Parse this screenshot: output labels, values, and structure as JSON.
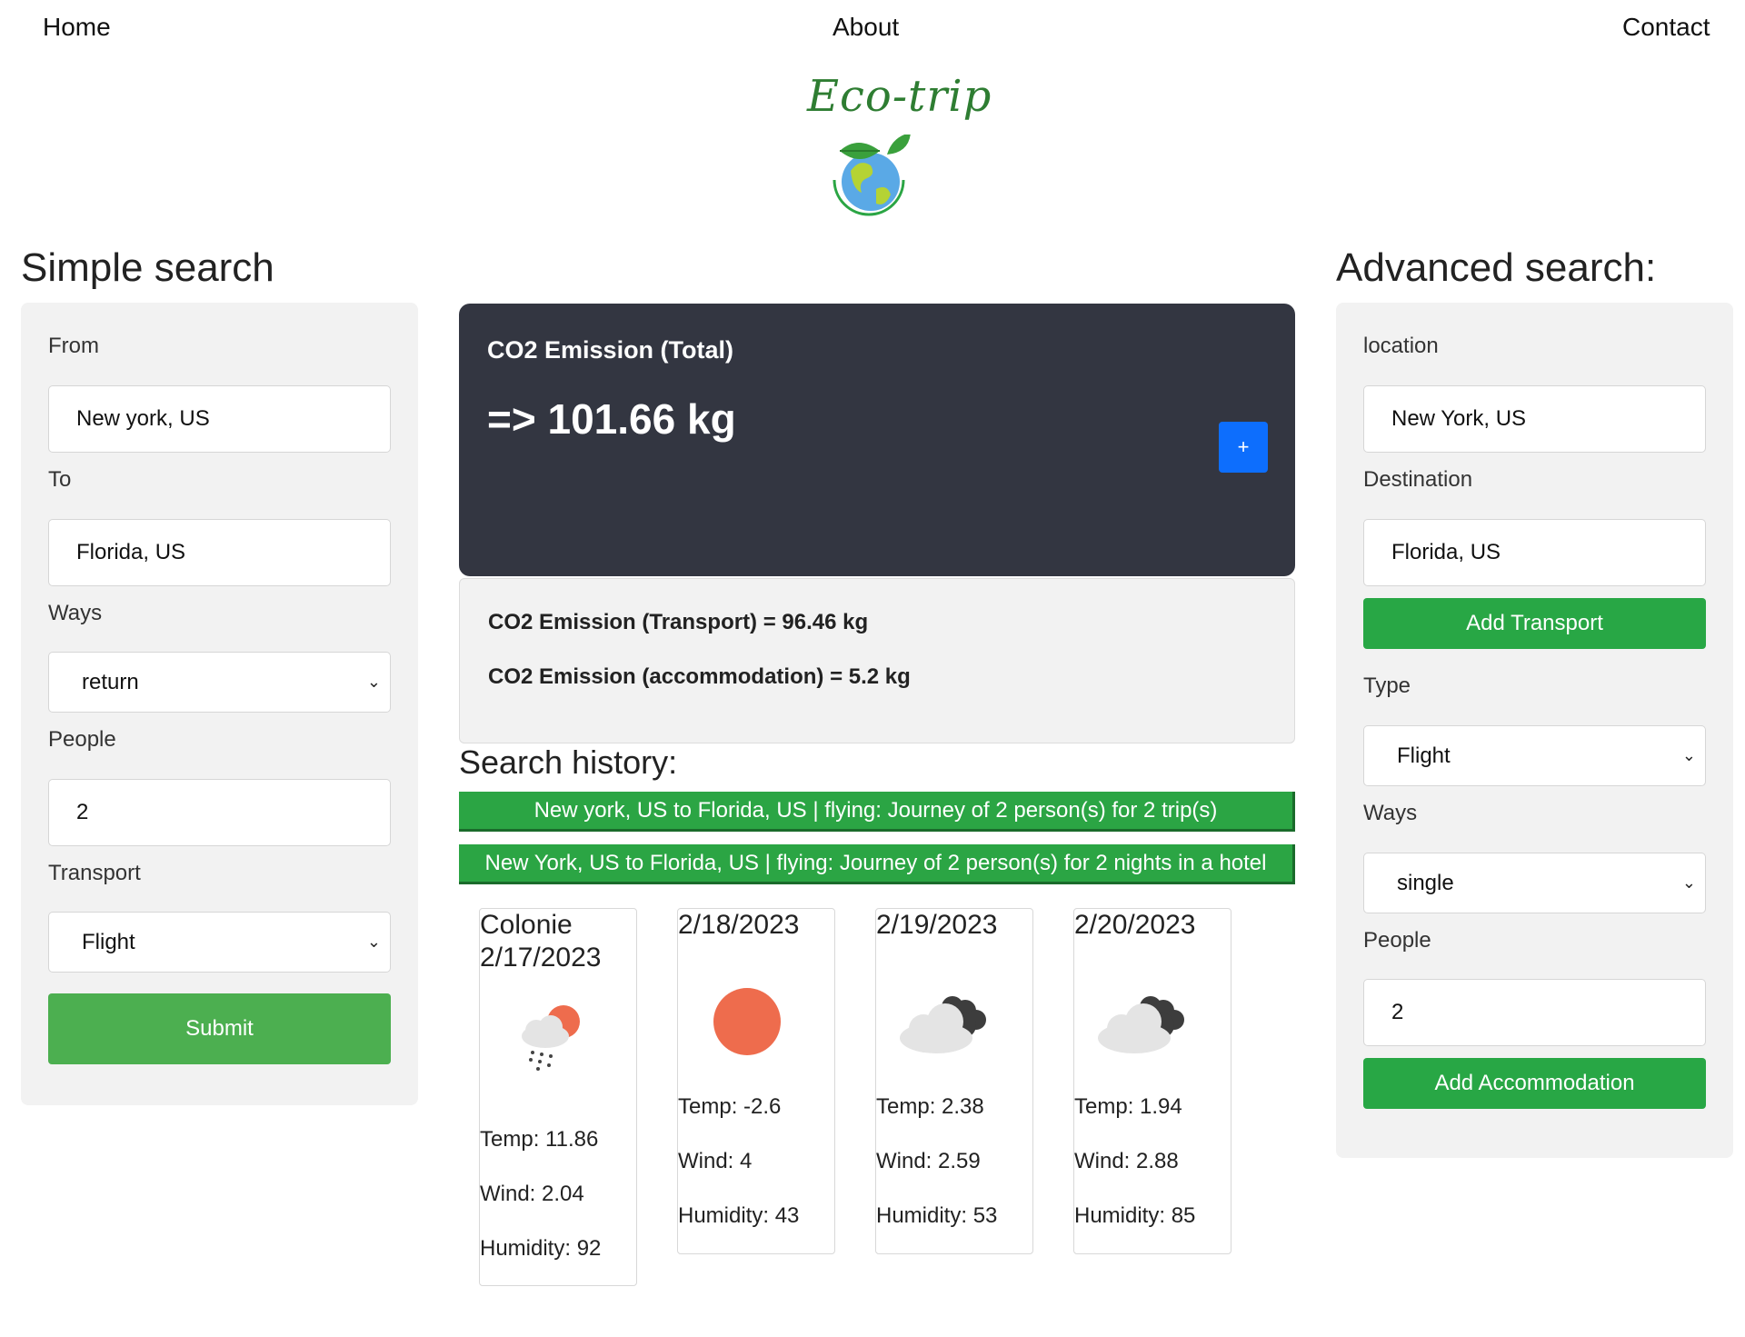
{
  "nav": {
    "home": "Home",
    "about": "About",
    "contact": "Contact"
  },
  "logo": {
    "text": "Eco-trip"
  },
  "simple_search": {
    "title": "Simple search",
    "from_label": "From",
    "from_value": "New york, US",
    "to_label": "To",
    "to_value": "Florida, US",
    "ways_label": "Ways",
    "ways_value": "return",
    "people_label": "People",
    "people_value": "2",
    "transport_label": "Transport",
    "transport_value": "Flight",
    "submit_label": "Submit"
  },
  "emission": {
    "title": "CO2 Emission (Total)",
    "total": "=> 101.66 kg",
    "plus_label": "+",
    "transport_line": "CO2 Emission (Transport) = 96.46 kg",
    "accommodation_line": "CO2 Emission (accommodation) = 5.2 kg"
  },
  "history": {
    "title": "Search history:",
    "items": [
      "New york, US to Florida, US | flying: Journey of 2 person(s) for 2 trip(s)",
      "New York, US to Florida, US | flying: Journey of 2 person(s) for 2 nights in a hotel"
    ]
  },
  "weather": [
    {
      "title_line1": "Colonie",
      "title_line2": "2/17/2023",
      "icon": "rain-sun-icon",
      "temp": "Temp: 11.86",
      "wind": "Wind: 2.04",
      "humidity": "Humidity: 92"
    },
    {
      "title_line1": "2/18/2023",
      "title_line2": "",
      "icon": "sun-icon",
      "temp": "Temp: -2.6",
      "wind": "Wind: 4",
      "humidity": "Humidity: 43"
    },
    {
      "title_line1": "2/19/2023",
      "title_line2": "",
      "icon": "cloudy-icon",
      "temp": "Temp: 2.38",
      "wind": "Wind: 2.59",
      "humidity": "Humidity: 53"
    },
    {
      "title_line1": "2/20/2023",
      "title_line2": "",
      "icon": "cloudy-icon",
      "temp": "Temp: 1.94",
      "wind": "Wind: 2.88",
      "humidity": "Humidity: 85"
    }
  ],
  "advanced_search": {
    "title": "Advanced search:",
    "location_label": "location",
    "location_value": "New York, US",
    "destination_label": "Destination",
    "destination_value": "Florida, US",
    "add_transport_label": "Add Transport",
    "type_label": "Type",
    "type_value": "Flight",
    "ways_label": "Ways",
    "ways_value": "single",
    "people_label": "People",
    "people_value": "2",
    "add_accommodation_label": "Add Accommodation"
  },
  "colors": {
    "submit_green": "#4caf50",
    "action_green": "#28a745",
    "card_dark": "#333641",
    "accent_blue": "#0d6efd",
    "panel_gray": "#f2f2f2"
  }
}
